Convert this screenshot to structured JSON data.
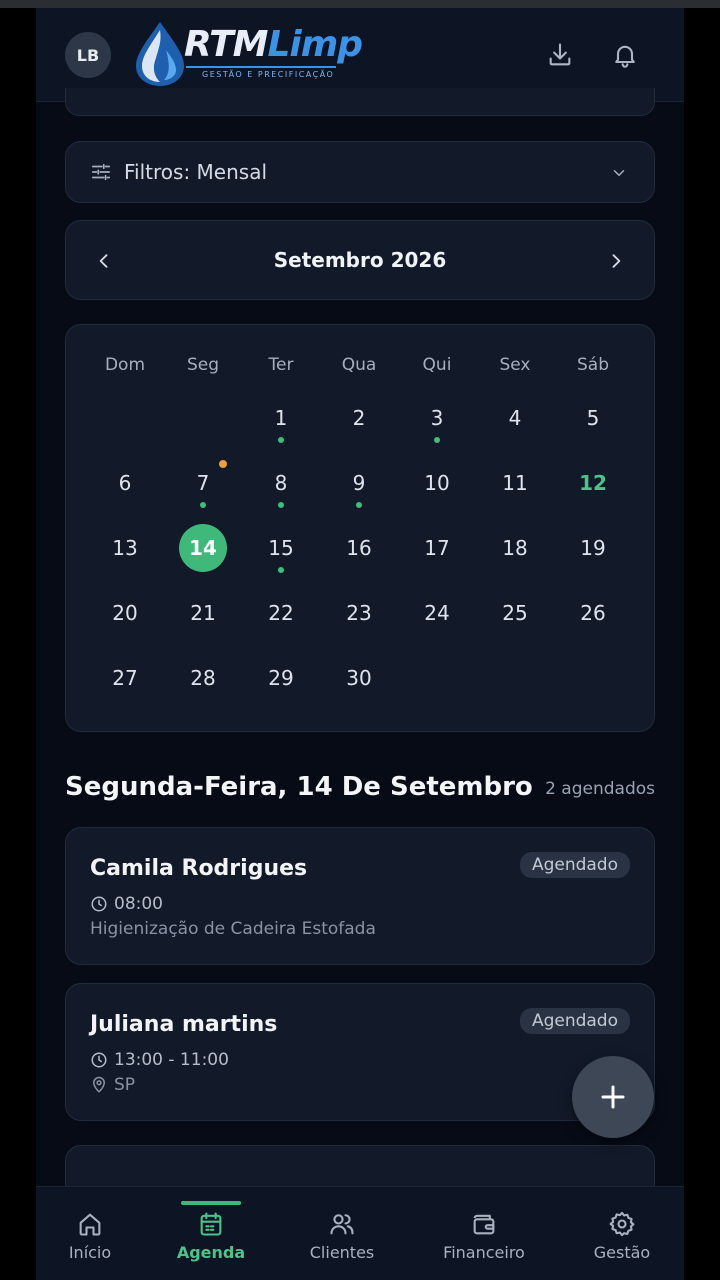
{
  "header": {
    "avatar_initials": "LB",
    "logo_main": "RTM",
    "logo_accent": "Limp",
    "logo_tagline": "GESTÃO E PRECIFICAÇÃO"
  },
  "filter": {
    "label": "Filtros: Mensal"
  },
  "calendar": {
    "month_title": "Setembro 2026",
    "weekdays": [
      "Dom",
      "Seg",
      "Ter",
      "Qua",
      "Qui",
      "Sex",
      "Sáb"
    ],
    "selected_day": 14,
    "days": [
      "1",
      "2",
      "3",
      "4",
      "5",
      "6",
      "7",
      "8",
      "9",
      "10",
      "11",
      "12",
      "13",
      "14",
      "15",
      "16",
      "17",
      "18",
      "19",
      "20",
      "21",
      "22",
      "23",
      "24",
      "25",
      "26",
      "27",
      "28",
      "29",
      "30"
    ]
  },
  "agenda": {
    "day_heading": "Segunda-Feira, 14 De Setembro",
    "count": "2 agendados",
    "appointments": [
      {
        "name": "Camila Rodrigues",
        "status": "Agendado",
        "time": "08:00",
        "detail": "Higienização de Cadeira Estofada"
      },
      {
        "name": "Juliana martins",
        "status": "Agendado",
        "time": "13:00 - 11:00",
        "location": "SP"
      }
    ]
  },
  "nav": {
    "items": [
      {
        "label": "Início"
      },
      {
        "label": "Agenda"
      },
      {
        "label": "Clientes"
      },
      {
        "label": "Financeiro"
      },
      {
        "label": "Gestão"
      }
    ]
  },
  "colors": {
    "accent": "#3fb97a",
    "background": "#060b16",
    "card": "#121a2a",
    "event_dot": "#3fbf7f",
    "warn_dot": "#e8a13d"
  }
}
